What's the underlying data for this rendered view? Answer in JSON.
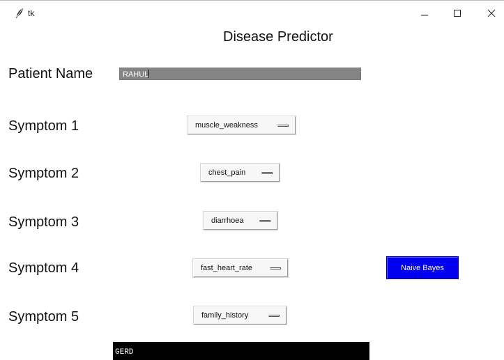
{
  "window": {
    "title": "tk",
    "icon": "feather-icon",
    "controls": [
      "minimize-icon",
      "maximize-icon",
      "close-icon"
    ]
  },
  "heading": "Disease Predictor",
  "patient": {
    "label": "Patient Name",
    "value": "RAHUL"
  },
  "symptoms": [
    {
      "label": "Symptom 1",
      "selected": "muscle_weakness"
    },
    {
      "label": "Symptom 2",
      "selected": "chest_pain"
    },
    {
      "label": "Symptom 3",
      "selected": "diarrhoea"
    },
    {
      "label": "Symptom 4",
      "selected": "fast_heart_rate"
    },
    {
      "label": "Symptom 5",
      "selected": "family_history"
    }
  ],
  "actions": {
    "naive_bayes_label": "Naive Bayes"
  },
  "result": {
    "text": "GERD"
  },
  "colors": {
    "entry_bg": "#858585",
    "button_bg": "#0000ee",
    "result_bg": "#000000",
    "result_fg": "#ffffff"
  }
}
